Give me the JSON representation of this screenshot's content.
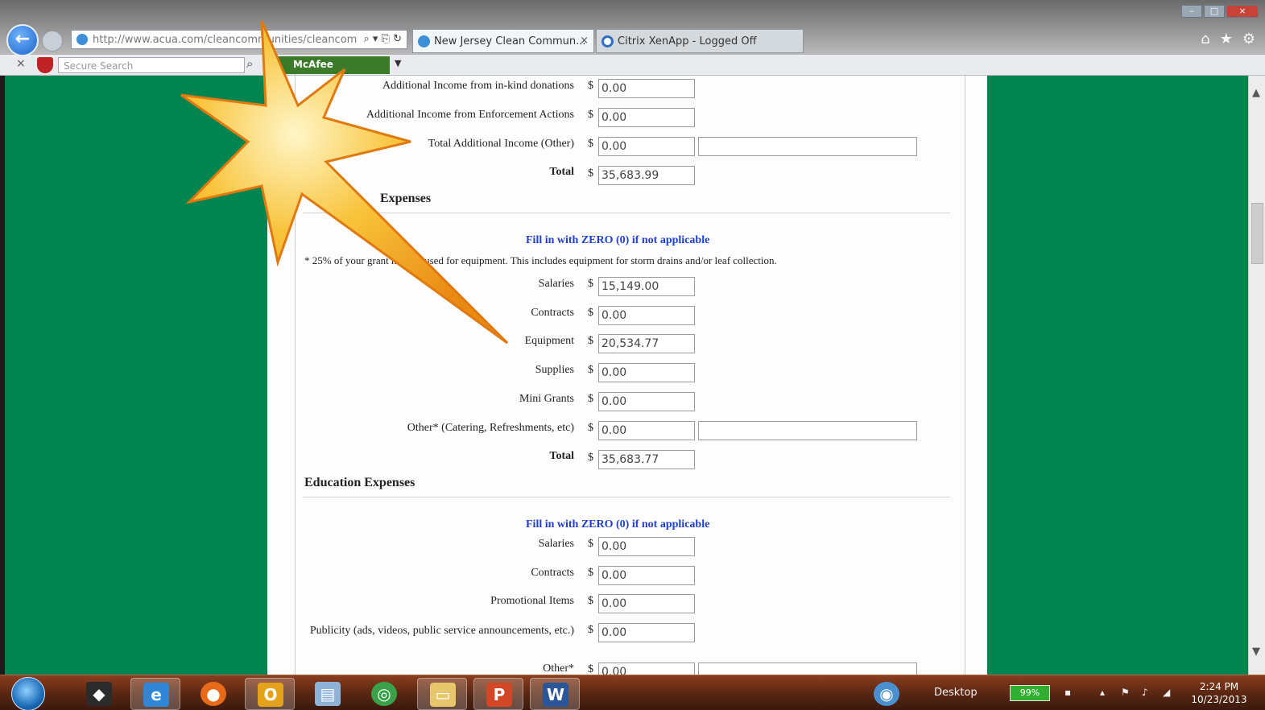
{
  "browser": {
    "address": "http://www.acua.com/cleancommunities/cleancom",
    "tabs": [
      {
        "title": "New Jersey Clean Commun...",
        "close": "×"
      },
      {
        "title": "Citrix XenApp - Logged Off"
      }
    ],
    "toolbar": {
      "close": "×",
      "search_placeholder": "Secure Search",
      "mcafee": "McAfee"
    }
  },
  "form": {
    "currency": "$",
    "income_rows": [
      {
        "label": "Additional Income from in-kind donations",
        "value": "0.00"
      },
      {
        "label": "Additional Income from Enforcement Actions",
        "value": "0.00"
      },
      {
        "label": "Total Additional Income (Other)",
        "value": "0.00",
        "extra": ""
      },
      {
        "label": "Total",
        "value": "35,683.99"
      }
    ],
    "section1": {
      "title": "Expenses",
      "fill_note": "Fill in with ZERO (0) if not applicable",
      "equipment_note": "* 25% of your grant may be used for equipment. This includes equipment for storm drains and/or leaf collection.",
      "rows": [
        {
          "label": "Salaries",
          "value": "15,149.00"
        },
        {
          "label": "Contracts",
          "value": "0.00"
        },
        {
          "label": "Equipment",
          "value": "20,534.77"
        },
        {
          "label": "Supplies",
          "value": "0.00"
        },
        {
          "label": "Mini Grants",
          "value": "0.00"
        },
        {
          "label": "Other* (Catering, Refreshments, etc)",
          "value": "0.00",
          "extra": ""
        },
        {
          "label": "Total",
          "value": "35,683.77"
        }
      ]
    },
    "section2": {
      "title": "Education Expenses",
      "fill_note": "Fill in with ZERO (0) if not applicable",
      "rows": [
        {
          "label": "Salaries",
          "value": "0.00"
        },
        {
          "label": "Contracts",
          "value": "0.00"
        },
        {
          "label": "Promotional Items",
          "value": "0.00"
        },
        {
          "label": "Publicity (ads, videos, public service announcements, etc.)",
          "value": "0.00"
        },
        {
          "label": "Other*",
          "value": "0.00",
          "extra": ""
        }
      ]
    }
  },
  "taskbar": {
    "apps": [
      "start",
      "media",
      "internet-explorer",
      "firefox",
      "outlook",
      "document",
      "chrome",
      "explorer",
      "powerpoint",
      "word"
    ],
    "desktop_label": "Desktop",
    "battery": "99%",
    "time": "2:24 PM",
    "date": "10/23/2013"
  },
  "colors": {
    "page_green": "#008550",
    "link_blue": "#1f3fd0",
    "taskbar": "#5c2813",
    "star_fill": "#f7c23a"
  }
}
